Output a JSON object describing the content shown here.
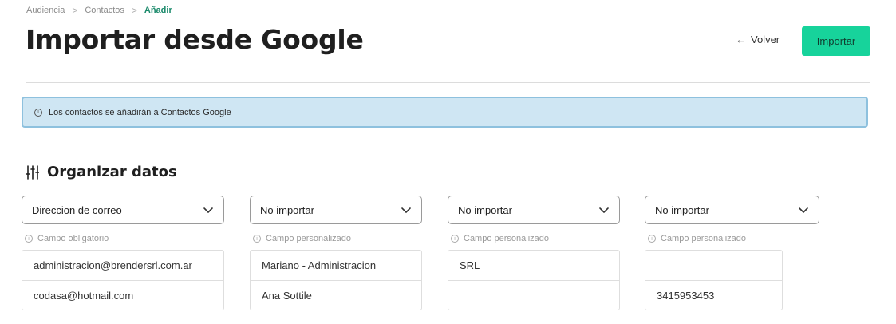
{
  "breadcrumb": {
    "items": [
      "Audiencia",
      "Contactos"
    ],
    "current": "Añadir",
    "separator": ">"
  },
  "header": {
    "title": "Importar desde Google",
    "back_label": "Volver",
    "import_label": "Importar"
  },
  "banner": {
    "text": "Los contactos se añadirán a Contactos Google"
  },
  "section": {
    "title": "Organizar datos"
  },
  "columns": [
    {
      "select": "Direccion de correo",
      "hint": "Campo obligatorio",
      "cells": [
        "administracion@brendersrl.com.ar",
        "codasa@hotmail.com"
      ]
    },
    {
      "select": "No importar",
      "hint": "Campo personalizado",
      "cells": [
        "Mariano - Administracion",
        "Ana Sottile"
      ]
    },
    {
      "select": "No importar",
      "hint": "Campo personalizado",
      "cells": [
        "SRL",
        ""
      ]
    },
    {
      "select": "No importar",
      "hint": "Campo personalizado",
      "cells": [
        "",
        "3415953453"
      ]
    }
  ],
  "colors": {
    "accent": "#17d39b",
    "breadcrumb_current": "#1b8a6b",
    "banner_bg": "#cfe6f3",
    "banner_border": "#8ec1de"
  }
}
